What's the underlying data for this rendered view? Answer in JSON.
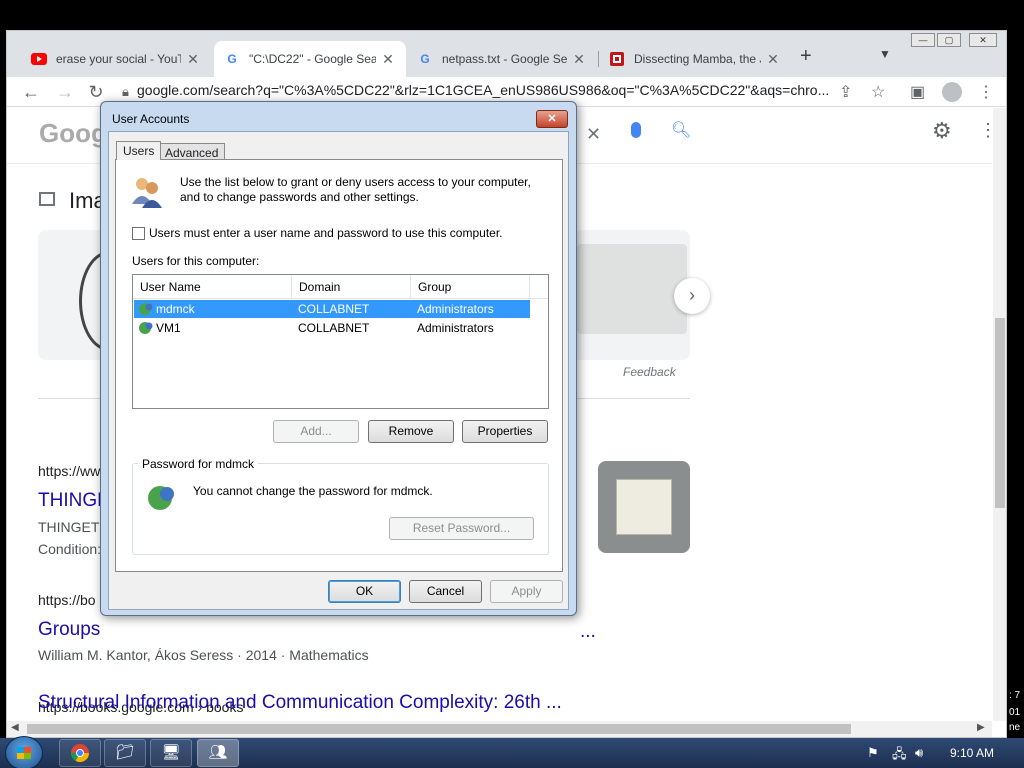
{
  "browser": {
    "tabs": [
      {
        "favicon": "youtube-icon",
        "title": "erase your social - YouTu",
        "color": "#ff0000"
      },
      {
        "favicon": "google-icon",
        "title": "\"C:\\DC22\" - Google Sear",
        "color": "#4285f4"
      },
      {
        "favicon": "google-icon",
        "title": "netpass.txt - Google Sea",
        "color": "#4285f4"
      },
      {
        "favicon": "mcafee-icon",
        "title": "Dissecting Mamba, the J",
        "color": "#c01818"
      }
    ],
    "new_tab": "+",
    "address": "google.com/search?q=\"C%3A%5CDC22\"&rlz=1C1GCEA_enUS986US986&oq=\"C%3A%5CDC22\"&aqs=chro..."
  },
  "google_page": {
    "logo": "Goog",
    "images_label": "Ima",
    "feedback": "Feedback",
    "results": [
      {
        "cite": "https://ww",
        "title": "THINGE",
        "snippet1": "THINGET",
        "snippet2": "Condition:"
      },
      {
        "cite": "https://bo",
        "title": "Groups",
        "snippet1": "William M. Kantor, Ákos Seress · 2014 · Mathematics",
        "snippet2": ""
      },
      {
        "cite": "https://books.google.com › books",
        "title": "Structural Information and Communication Complexity: 26th ...",
        "snippet1": "",
        "snippet2": ""
      }
    ],
    "ellipsis": "..."
  },
  "dialog": {
    "title": "User Accounts",
    "tabs": [
      "Users",
      "Advanced"
    ],
    "intro": "Use the list below to grant or deny users access to your computer, and to change passwords and other settings.",
    "checkbox_label": "Users must enter a user name and password to use this computer.",
    "checkbox_checked": false,
    "users_label": "Users for this computer:",
    "columns": [
      "User Name",
      "Domain",
      "Group"
    ],
    "users": [
      {
        "name": "mdmck",
        "domain": "COLLABNET",
        "group": "Administrators",
        "selected": true
      },
      {
        "name": "VM1",
        "domain": "COLLABNET",
        "group": "Administrators",
        "selected": false
      }
    ],
    "buttons": {
      "add": "Add...",
      "remove": "Remove",
      "properties": "Properties",
      "reset": "Reset Password...",
      "ok": "OK",
      "cancel": "Cancel",
      "apply": "Apply"
    },
    "password_group_title": "Password for mdmck",
    "password_text": "You cannot change the password for mdmck."
  },
  "taskbar": {
    "time": "9:10 AM",
    "edge_texts": [
      ": 7",
      "01",
      "ne"
    ]
  }
}
